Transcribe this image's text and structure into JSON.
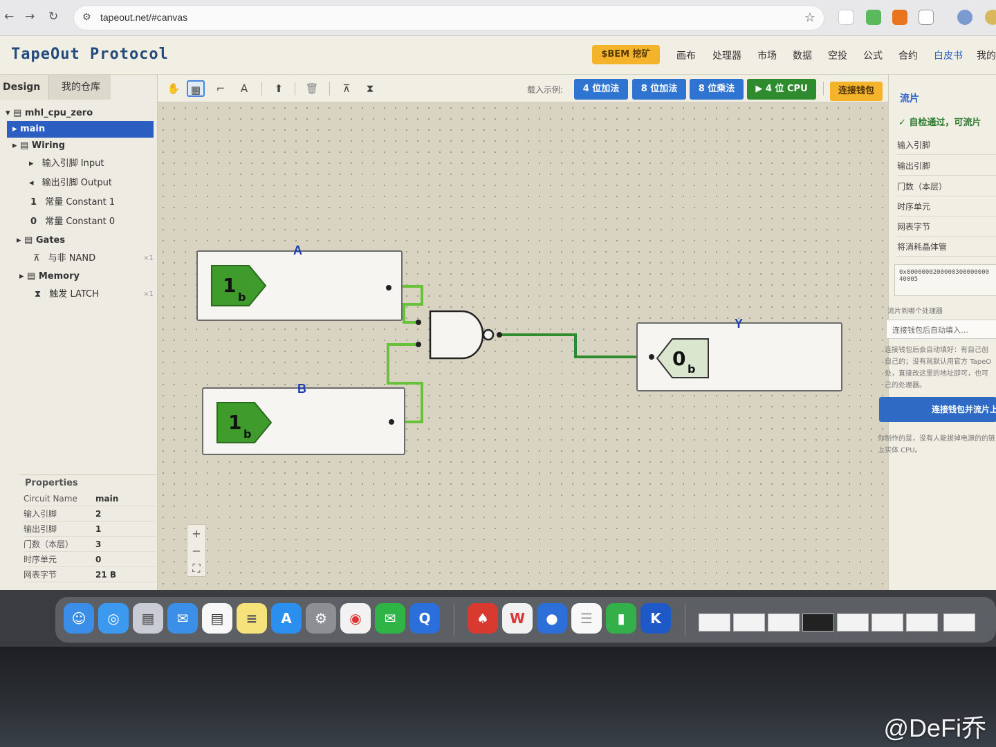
{
  "browser": {
    "url": "tapeout.net/#canvas"
  },
  "app": {
    "logo": "TapeOut Protocol",
    "bem_button": "$BEM 挖矿",
    "nav": [
      "画布",
      "处理器",
      "市场",
      "数据",
      "空投",
      "公式",
      "合约",
      "白皮书",
      "我的"
    ],
    "nav_active": "白皮书"
  },
  "left_panel": {
    "tabs": [
      "Design",
      "我的仓库"
    ],
    "tree": [
      {
        "label": "mhl_cpu_zero"
      },
      {
        "label": "main"
      },
      {
        "label": "Wiring"
      },
      {
        "label": "输入引脚 Input",
        "glyph": "▸"
      },
      {
        "label": "输出引脚 Output",
        "glyph": "◂"
      },
      {
        "label": "常量 Constant 1",
        "glyph": "1"
      },
      {
        "label": "常量 Constant 0",
        "glyph": "0"
      },
      {
        "label": "Gates"
      },
      {
        "label": "与非 NAND",
        "glyph": "⊼",
        "count": "×1"
      },
      {
        "label": "Memory"
      },
      {
        "label": "触发 LATCH",
        "glyph": "⧗",
        "count": "×1"
      }
    ],
    "properties_title": "Properties",
    "properties": [
      {
        "key": "Circuit Name",
        "value": "main"
      },
      {
        "key": "输入引脚",
        "value": "2"
      },
      {
        "key": "输出引脚",
        "value": "1"
      },
      {
        "key": "门数（本层）",
        "value": "3"
      },
      {
        "key": "时序单元",
        "value": "0"
      },
      {
        "key": "网表字节",
        "value": "21 B"
      }
    ]
  },
  "toolbar": {
    "tools": [
      "hand-icon",
      "select-icon",
      "wire-icon",
      "text-icon",
      "pin-icon",
      "trash-icon",
      "nand-icon",
      "latch-icon"
    ],
    "load_label": "载入示例:",
    "examples": [
      "4 位加法",
      "8 位加法",
      "8 位乘法",
      "▶ 4 位 CPU"
    ],
    "wallet": "连接钱包"
  },
  "canvas": {
    "input_a": {
      "label": "A",
      "value": "1",
      "sub": "b"
    },
    "input_b": {
      "label": "B",
      "value": "1",
      "sub": "b"
    },
    "output_y": {
      "label": "Y",
      "value": "0",
      "sub": "b"
    },
    "zoom": [
      "+",
      "−",
      "⛶"
    ]
  },
  "right_panel": {
    "title": "流片",
    "status": "✓ 自检通过，可流片",
    "rows": [
      "输入引脚",
      "输出引脚",
      "门数（本层）",
      "时序单元",
      "网表字节",
      "将消耗晶体管"
    ],
    "hash": "0x000000020000030000000040005",
    "target_label": "流片到哪个处理器",
    "target_placeholder": "连接钱包后自动填入…",
    "hint": "连接钱包后会自动填好：有自己创自己的；没有就默认用官方 TapeO处，直接改这里的地址即可，也可己的处理器。",
    "big_button": "连接钱包并流片上",
    "footer": "你制作的是，没有人能拔掉电源的的链上实体 CPU。"
  },
  "watermark": "@DeFi乔",
  "colors": {
    "accent": "#2a5fc1",
    "wire": "#2e8b2e",
    "wire_light": "#67c23a",
    "bem": "#f3b32b"
  }
}
